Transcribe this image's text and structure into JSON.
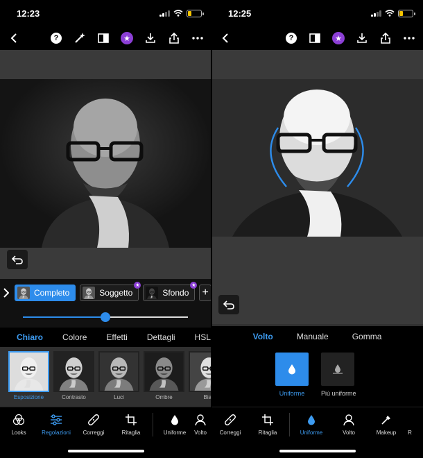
{
  "left": {
    "status": {
      "time": "12:23"
    },
    "chips": [
      {
        "label": "Completo",
        "active": true,
        "premium": false
      },
      {
        "label": "Soggetto",
        "active": false,
        "premium": true
      },
      {
        "label": "Sfondo",
        "active": false,
        "premium": true
      }
    ],
    "slider": {
      "value": 0.5
    },
    "tabs": [
      "Chiaro",
      "Colore",
      "Effetti",
      "Dettagli",
      "HSL"
    ],
    "active_tab": 0,
    "thumbnails": [
      "Esposizione",
      "Contrasto",
      "Luci",
      "Ombre",
      "Bian"
    ],
    "active_thumbnail": 0,
    "nav": [
      {
        "label": "Looks",
        "icon": "looks-icon"
      },
      {
        "label": "Regolazioni",
        "icon": "sliders-icon",
        "active": true
      },
      {
        "label": "Correggi",
        "icon": "bandage-icon"
      },
      {
        "label": "Ritaglia",
        "icon": "crop-icon"
      },
      {
        "label": "Uniforme",
        "icon": "drop-icon"
      },
      {
        "label": "Volto",
        "icon": "face-icon"
      }
    ]
  },
  "right": {
    "status": {
      "time": "12:25"
    },
    "tabs": [
      "Volto",
      "Manuale",
      "Gomma"
    ],
    "active_tab": 0,
    "options": [
      {
        "label": "Uniforme",
        "active": true
      },
      {
        "label": "Più uniforme",
        "active": false
      }
    ],
    "nav": [
      {
        "label": "Correggi",
        "icon": "bandage-icon"
      },
      {
        "label": "Ritaglia",
        "icon": "crop-icon"
      },
      {
        "label": "Uniforme",
        "icon": "drop-icon",
        "active": true
      },
      {
        "label": "Volto",
        "icon": "face-icon"
      },
      {
        "label": "Makeup",
        "icon": "brush-icon"
      },
      {
        "label": "R",
        "icon": "more-icon"
      }
    ]
  },
  "colors": {
    "accent": "#2d8ceb",
    "premium": "#8c3fd6",
    "battery": "#f5c400"
  }
}
